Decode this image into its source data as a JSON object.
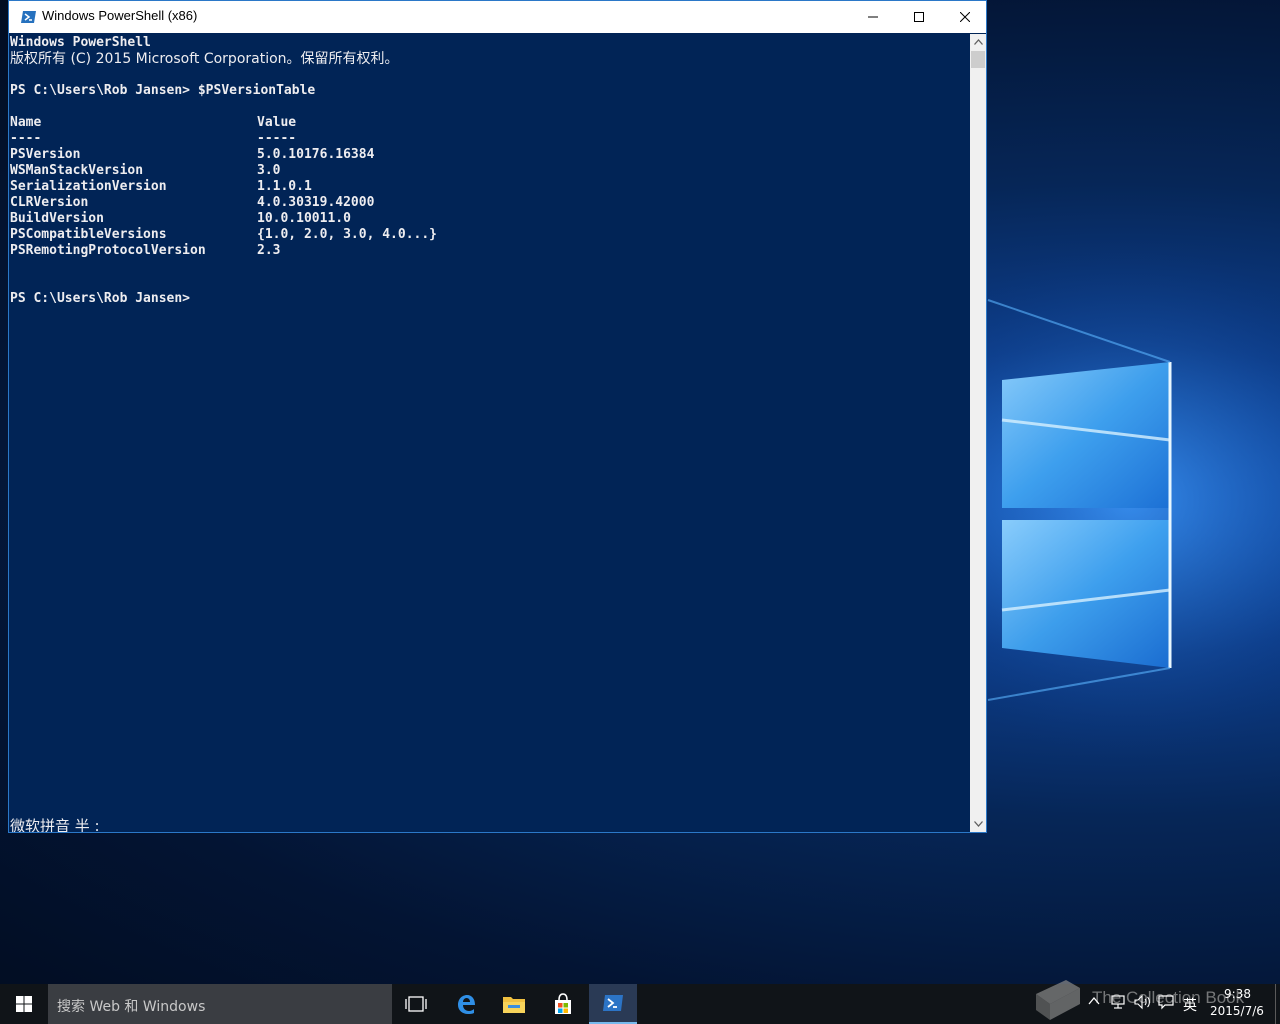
{
  "window": {
    "title": "Windows PowerShell (x86)"
  },
  "console": {
    "header1": "Windows PowerShell",
    "header2": "版权所有 (C) 2015 Microsoft Corporation。保留所有权利。",
    "prompt1": "PS C:\\Users\\Rob Jansen> $PSVersionTable",
    "table": {
      "col_name": "Name",
      "col_value": "Value",
      "sep_name": "----",
      "sep_value": "-----",
      "rows": [
        {
          "name": "PSVersion",
          "value": "5.0.10176.16384"
        },
        {
          "name": "WSManStackVersion",
          "value": "3.0"
        },
        {
          "name": "SerializationVersion",
          "value": "1.1.0.1"
        },
        {
          "name": "CLRVersion",
          "value": "4.0.30319.42000"
        },
        {
          "name": "BuildVersion",
          "value": "10.0.10011.0"
        },
        {
          "name": "PSCompatibleVersions",
          "value": "{1.0, 2.0, 3.0, 4.0...}"
        },
        {
          "name": "PSRemotingProtocolVersion",
          "value": "2.3"
        }
      ]
    },
    "prompt2": "PS C:\\Users\\Rob Jansen>",
    "ime_status": "微软拼音 半 :"
  },
  "taskbar": {
    "search_placeholder": "搜索 Web 和 Windows",
    "tray_ime": "英",
    "clock_time": "9:38",
    "clock_date": "2015/7/6",
    "watermark": "The Collection Book"
  },
  "colors": {
    "console_bg": "#012456",
    "console_fg": "#eeedf0",
    "taskbar_bg": "#101418",
    "accent": "#76b9ed"
  }
}
